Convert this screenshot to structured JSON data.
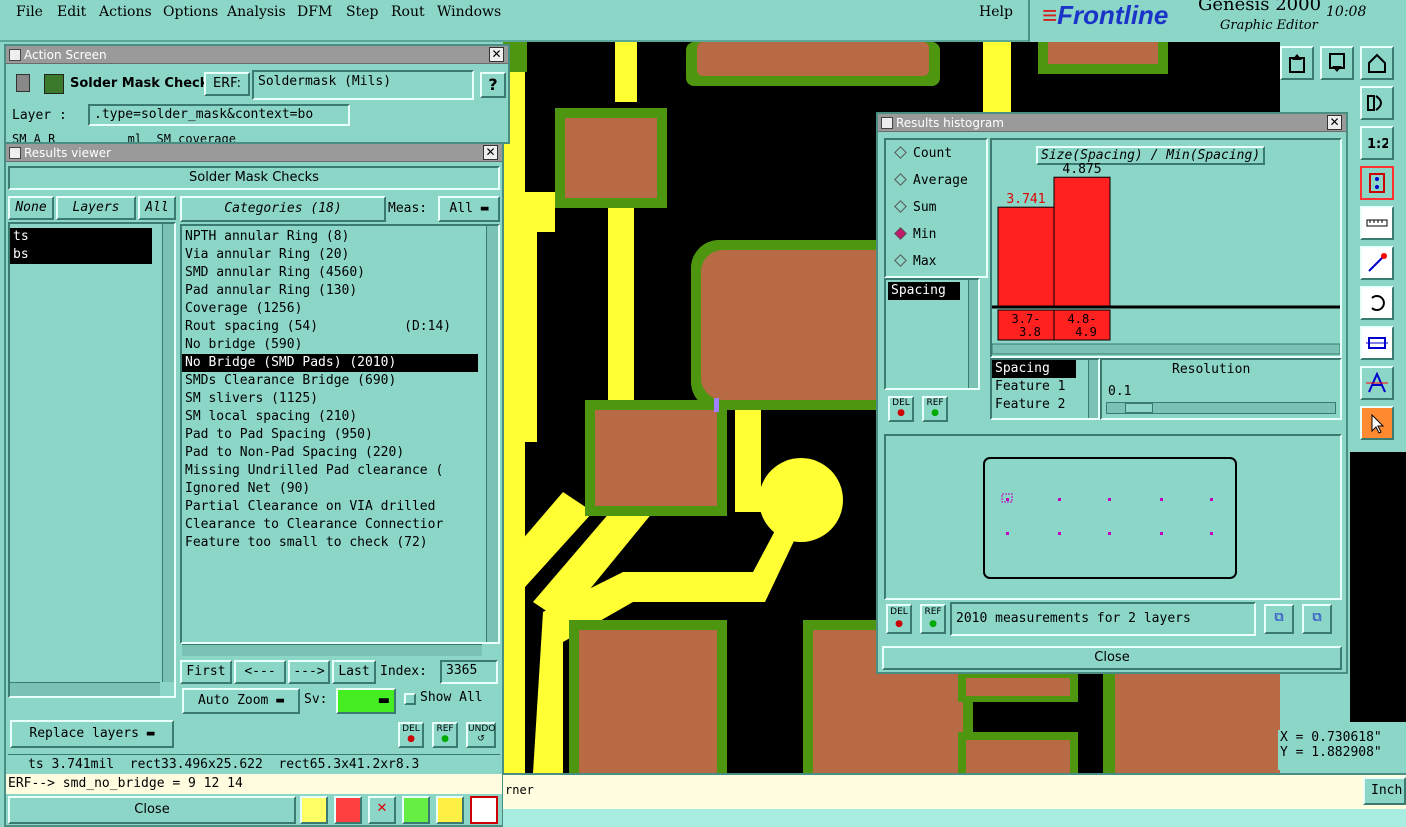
{
  "menu": {
    "items": [
      "File",
      "Edit",
      "Actions",
      "Options",
      "Analysis",
      "DFM",
      "Step",
      "Rout",
      "Windows"
    ],
    "help": "Help"
  },
  "brand": {
    "logo": "Frontline",
    "app": "Genesis 2000",
    "subtitle": "Graphic Editor",
    "time": "10:08"
  },
  "action_screen": {
    "title": "Action Screen",
    "check_name": "Solder Mask Checks",
    "erf_label": "ERF:",
    "erf_value": "Soldermask (Mils)",
    "help_label": "?",
    "layer_label": "Layer :",
    "layer_value": ".type=solder_mask&context=bo",
    "partial_row": "SM A R          ml  SM coverage"
  },
  "results_viewer": {
    "title": "Results viewer",
    "header": "Solder Mask Checks",
    "none_btn": "None",
    "layers_btn": "Layers",
    "all_btn": "All",
    "layers": [
      "ts",
      "bs"
    ],
    "categories_btn": "Categories (18)",
    "meas_label": "Meas:",
    "meas_value": "All",
    "categories": [
      "NPTH annular Ring (8)",
      "Via annular Ring (20)",
      "SMD annular Ring (4560)",
      "Pad annular Ring (130)",
      "Coverage (1256)",
      "Rout spacing (54)           (D:14)",
      "No bridge (590)",
      "No Bridge (SMD Pads) (2010)",
      "SMDs Clearance Bridge (690)",
      "SM slivers (1125)",
      "SM local spacing (210)",
      "Pad to Pad Spacing (950)",
      "Pad to Non-Pad Spacing (220)",
      "Missing Undrilled Pad clearance (",
      "Ignored Net (90)",
      "Partial Clearance on VIA drilled",
      "Clearance to Clearance Connectior",
      "Feature too small to check (72)"
    ],
    "selected_index": 7,
    "nav": {
      "first": "First",
      "prev": "<---",
      "next": "--->",
      "last": "Last",
      "index_label": "Index:",
      "index_value": "3365"
    },
    "auto_zoom": "Auto Zoom",
    "sv_label": "Sv:",
    "show_all": "Show All",
    "replace_layers": "Replace layers",
    "del": "DEL",
    "ref": "REF",
    "undo": "UNDO",
    "status_line": "ts 3.741mil  rect33.496x25.622  rect65.3x41.2xr8.3",
    "erf_line": "ERF--> smd_no_bridge = 9 12 14",
    "close": "Close"
  },
  "histogram": {
    "title": "Results histogram",
    "radio_options": [
      "Count",
      "Average",
      "Sum",
      "Min",
      "Max"
    ],
    "selected_option": "Min",
    "list_item": "Spacing",
    "chart_title": "Size(Spacing) / Min(Spacing)",
    "sort_list": [
      "Spacing",
      "Feature 1",
      "Feature 2"
    ],
    "resolution_label": "Resolution",
    "resolution_value": "0.1",
    "resolution_slider": 0.08,
    "summary": "2010 measurements for 2 layers",
    "close": "Close",
    "del": "DEL",
    "ref": "REF"
  },
  "chart_data": {
    "type": "bar",
    "title": "Size(Spacing) / Min(Spacing)",
    "categories": [
      "3.7-\n3.8",
      "4.8-\n4.9"
    ],
    "category_lines": [
      [
        "3.7-",
        "3.8"
      ],
      [
        "4.8-",
        "4.9"
      ]
    ],
    "values": [
      3.741,
      4.875
    ],
    "value_labels": [
      "3.741",
      "4.875"
    ],
    "value_label_colors": [
      "#e00000",
      "#000000"
    ],
    "bar_color": "#ff2020",
    "ylim": [
      0,
      5.3
    ],
    "grid": false
  },
  "coords": {
    "x": "X = 0.730618\"",
    "y": "Y = 1.882908\""
  },
  "bottom": {
    "hint": "rner",
    "units": "Inch"
  },
  "colors": {
    "background": "#8cd6c8",
    "copper": "#b86a45",
    "mask": "#4f9610",
    "trace": "#ffff33",
    "canvas": "#000000"
  }
}
